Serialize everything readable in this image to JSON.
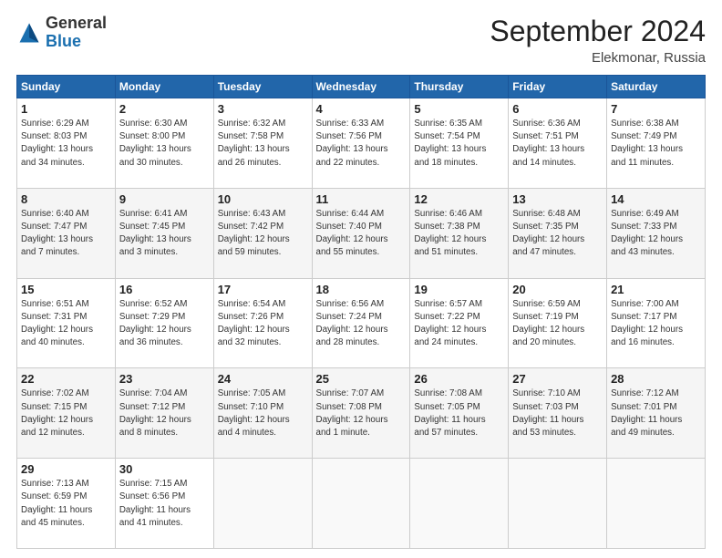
{
  "header": {
    "logo_general": "General",
    "logo_blue": "Blue",
    "month_year": "September 2024",
    "location": "Elekmonar, Russia"
  },
  "days_of_week": [
    "Sunday",
    "Monday",
    "Tuesday",
    "Wednesday",
    "Thursday",
    "Friday",
    "Saturday"
  ],
  "weeks": [
    [
      {
        "day": "1",
        "info": "Sunrise: 6:29 AM\nSunset: 8:03 PM\nDaylight: 13 hours\nand 34 minutes."
      },
      {
        "day": "2",
        "info": "Sunrise: 6:30 AM\nSunset: 8:00 PM\nDaylight: 13 hours\nand 30 minutes."
      },
      {
        "day": "3",
        "info": "Sunrise: 6:32 AM\nSunset: 7:58 PM\nDaylight: 13 hours\nand 26 minutes."
      },
      {
        "day": "4",
        "info": "Sunrise: 6:33 AM\nSunset: 7:56 PM\nDaylight: 13 hours\nand 22 minutes."
      },
      {
        "day": "5",
        "info": "Sunrise: 6:35 AM\nSunset: 7:54 PM\nDaylight: 13 hours\nand 18 minutes."
      },
      {
        "day": "6",
        "info": "Sunrise: 6:36 AM\nSunset: 7:51 PM\nDaylight: 13 hours\nand 14 minutes."
      },
      {
        "day": "7",
        "info": "Sunrise: 6:38 AM\nSunset: 7:49 PM\nDaylight: 13 hours\nand 11 minutes."
      }
    ],
    [
      {
        "day": "8",
        "info": "Sunrise: 6:40 AM\nSunset: 7:47 PM\nDaylight: 13 hours\nand 7 minutes."
      },
      {
        "day": "9",
        "info": "Sunrise: 6:41 AM\nSunset: 7:45 PM\nDaylight: 13 hours\nand 3 minutes."
      },
      {
        "day": "10",
        "info": "Sunrise: 6:43 AM\nSunset: 7:42 PM\nDaylight: 12 hours\nand 59 minutes."
      },
      {
        "day": "11",
        "info": "Sunrise: 6:44 AM\nSunset: 7:40 PM\nDaylight: 12 hours\nand 55 minutes."
      },
      {
        "day": "12",
        "info": "Sunrise: 6:46 AM\nSunset: 7:38 PM\nDaylight: 12 hours\nand 51 minutes."
      },
      {
        "day": "13",
        "info": "Sunrise: 6:48 AM\nSunset: 7:35 PM\nDaylight: 12 hours\nand 47 minutes."
      },
      {
        "day": "14",
        "info": "Sunrise: 6:49 AM\nSunset: 7:33 PM\nDaylight: 12 hours\nand 43 minutes."
      }
    ],
    [
      {
        "day": "15",
        "info": "Sunrise: 6:51 AM\nSunset: 7:31 PM\nDaylight: 12 hours\nand 40 minutes."
      },
      {
        "day": "16",
        "info": "Sunrise: 6:52 AM\nSunset: 7:29 PM\nDaylight: 12 hours\nand 36 minutes."
      },
      {
        "day": "17",
        "info": "Sunrise: 6:54 AM\nSunset: 7:26 PM\nDaylight: 12 hours\nand 32 minutes."
      },
      {
        "day": "18",
        "info": "Sunrise: 6:56 AM\nSunset: 7:24 PM\nDaylight: 12 hours\nand 28 minutes."
      },
      {
        "day": "19",
        "info": "Sunrise: 6:57 AM\nSunset: 7:22 PM\nDaylight: 12 hours\nand 24 minutes."
      },
      {
        "day": "20",
        "info": "Sunrise: 6:59 AM\nSunset: 7:19 PM\nDaylight: 12 hours\nand 20 minutes."
      },
      {
        "day": "21",
        "info": "Sunrise: 7:00 AM\nSunset: 7:17 PM\nDaylight: 12 hours\nand 16 minutes."
      }
    ],
    [
      {
        "day": "22",
        "info": "Sunrise: 7:02 AM\nSunset: 7:15 PM\nDaylight: 12 hours\nand 12 minutes."
      },
      {
        "day": "23",
        "info": "Sunrise: 7:04 AM\nSunset: 7:12 PM\nDaylight: 12 hours\nand 8 minutes."
      },
      {
        "day": "24",
        "info": "Sunrise: 7:05 AM\nSunset: 7:10 PM\nDaylight: 12 hours\nand 4 minutes."
      },
      {
        "day": "25",
        "info": "Sunrise: 7:07 AM\nSunset: 7:08 PM\nDaylight: 12 hours\nand 1 minute."
      },
      {
        "day": "26",
        "info": "Sunrise: 7:08 AM\nSunset: 7:05 PM\nDaylight: 11 hours\nand 57 minutes."
      },
      {
        "day": "27",
        "info": "Sunrise: 7:10 AM\nSunset: 7:03 PM\nDaylight: 11 hours\nand 53 minutes."
      },
      {
        "day": "28",
        "info": "Sunrise: 7:12 AM\nSunset: 7:01 PM\nDaylight: 11 hours\nand 49 minutes."
      }
    ],
    [
      {
        "day": "29",
        "info": "Sunrise: 7:13 AM\nSunset: 6:59 PM\nDaylight: 11 hours\nand 45 minutes."
      },
      {
        "day": "30",
        "info": "Sunrise: 7:15 AM\nSunset: 6:56 PM\nDaylight: 11 hours\nand 41 minutes."
      },
      {
        "day": "",
        "info": ""
      },
      {
        "day": "",
        "info": ""
      },
      {
        "day": "",
        "info": ""
      },
      {
        "day": "",
        "info": ""
      },
      {
        "day": "",
        "info": ""
      }
    ]
  ]
}
